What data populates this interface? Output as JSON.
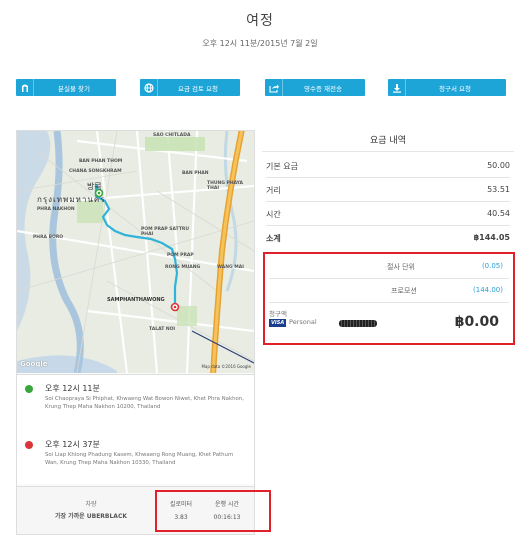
{
  "header": {
    "title": "여정",
    "subtitle": "오후 12시 11분/2015년 7월 2일"
  },
  "toolbar": {
    "buttons": [
      {
        "label": "분실물 찾기",
        "icon": "scarf-icon"
      },
      {
        "label": "요금 검토 요청",
        "icon": "globe-icon"
      },
      {
        "label": "영수증 재전송",
        "icon": "forward-icon"
      },
      {
        "label": "청구서 요청",
        "icon": "download-icon"
      }
    ],
    "color": "#1ea5d8"
  },
  "map": {
    "labels": [
      "SAO CHITLADA",
      "BAN PHAN THOM",
      "CHANA SONGKHRAM",
      "BAN PHAN",
      "THUNG PHAYA THAI",
      "PHRA NAKHON",
      "PHRA BORO",
      "POM PRAP SATTRU PHAI",
      "POM PRAP",
      "RONG MUANG",
      "WANG MAI",
      "SAMPHANTHAWONG",
      "TALAT NOI",
      "방콕",
      "กรุงเทพมหานคร"
    ],
    "copyright": "Map data ©2016 Google",
    "logo": "Google"
  },
  "trip": {
    "pickup": {
      "time": "오후 12시 11분",
      "address": "Soi Chaopraya Si Phiphat, Khwaeng Wat Bowon Niwet, Khet Phra Nakhon, Krung Thep Maha Nakhon 10200, Thailand"
    },
    "dropoff": {
      "time": "오후 12시 37분",
      "address": "Soi Liap Khlong Phadung Kasem, Khwaeng Rong Muang, Khet Pathum Wan, Krung Thep Maha Nakhon 10330, Thailand"
    }
  },
  "summary": {
    "vehicle_label": "차량",
    "vehicle_name": "가장 가까운 UBERBLACK",
    "distance_label": "킬로미터",
    "distance_value": "3.83",
    "duration_label": "운행 시간",
    "duration_value": "00:16:13"
  },
  "fare": {
    "title": "요금 내역",
    "rows": [
      {
        "label": "기본 요금",
        "value": "50.00"
      },
      {
        "label": "거리",
        "value": "53.51"
      },
      {
        "label": "시간",
        "value": "40.54"
      }
    ],
    "subtotal_label": "소계",
    "subtotal_value": "฿144.05",
    "adjustments": [
      {
        "label": "절사 단위",
        "value": "(0.05)"
      },
      {
        "label": "프로모션",
        "value": "(144.00)"
      }
    ],
    "charged_label": "청구액",
    "card_brand": "VISA",
    "card_name": "Personal",
    "total": "฿0.00"
  },
  "colors": {
    "highlight_border": "#e0202a",
    "link": "#2a9fd6",
    "route": "#2fb3d8",
    "pickup_pin": "#3aa53a",
    "dropoff_pin": "#d9353b"
  }
}
